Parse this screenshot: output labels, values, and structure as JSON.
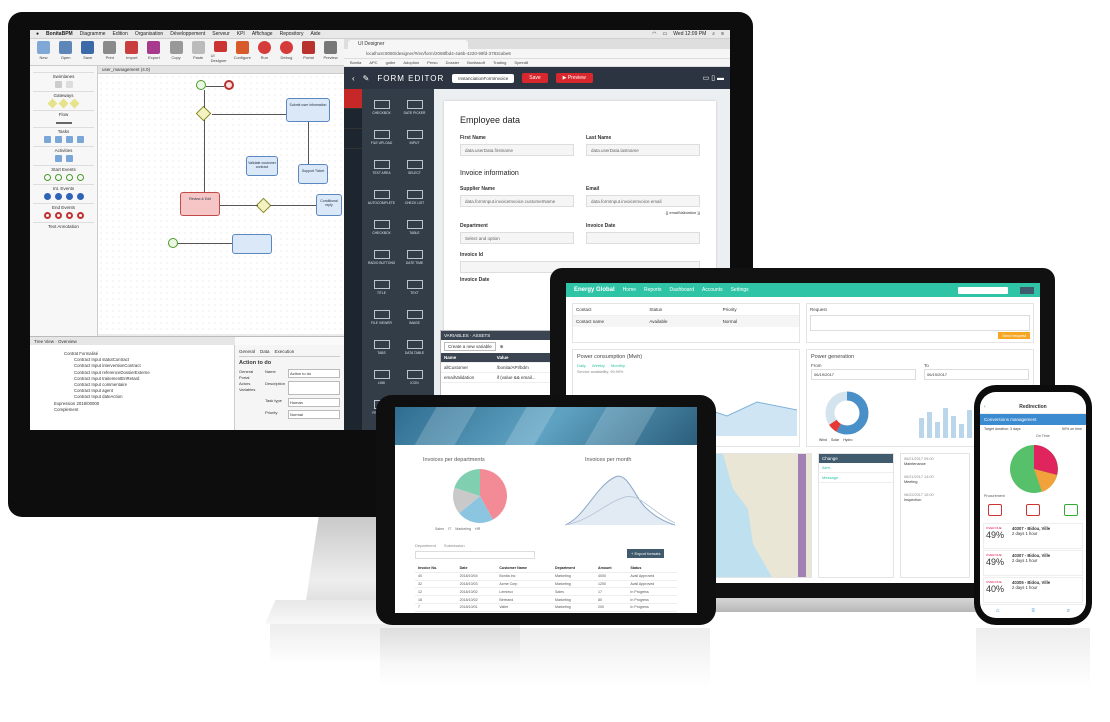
{
  "monitor": {
    "menubar": {
      "app": "BonitaBPM",
      "items": [
        "Diagramme",
        "Edition",
        "Organisation",
        "Développement",
        "Serveur",
        "KPI",
        "Affichage",
        "Repository",
        "Aide"
      ],
      "clock": "Wed 12:09 PM"
    },
    "studio": {
      "toolbar": [
        "New",
        "Open",
        "Save",
        "Print",
        "Import",
        "Export",
        "Copy",
        "Paste",
        "UI Designer",
        "Configure",
        "Run",
        "Debug",
        "Portal",
        "Preview"
      ],
      "palette": {
        "sections": [
          "Swimlanes",
          "Gateways",
          "Flow",
          "Tasks",
          "Activities",
          "Start Events",
          "Int. Events",
          "End Events",
          "Text Annotation"
        ]
      },
      "diagram_tab": "user_management (4.0)",
      "tasks": [
        {
          "label": "Submit user information"
        },
        {
          "label": "Validate customer contract"
        },
        {
          "label": "Support Ticket"
        },
        {
          "label": "Review & Edit"
        },
        {
          "label": "Conditional reply"
        }
      ],
      "tree_tab": "Tree View",
      "overview_tab": "Overview",
      "tree_items": [
        "Contrat Formalisé",
        "Contract Input statutContract",
        "Contract Input interventionContract",
        "Contract Input referenceDossierExterne",
        "Contract Input traitementEnRetard",
        "Contract Input commentaire",
        "Contract Input agent",
        "Contract Input dateAction",
        "Expression 2018/00000",
        "Complement"
      ],
      "props": {
        "tabs": [
          "General",
          "Data",
          "Execution"
        ],
        "title": "Action to do",
        "section": "General",
        "sidebar": [
          "Portal",
          "Actors",
          "Variables"
        ],
        "fields": [
          {
            "label": "Name",
            "value": "Action to do"
          },
          {
            "label": "Description",
            "value": ""
          },
          {
            "label": "Task type",
            "value": "Human"
          },
          {
            "label": "Priority",
            "value": "Normal"
          }
        ]
      }
    },
    "browser": {
      "tab": "UI Designer",
      "url": "localhost:8080/designer/#/en/form/2068fbd4-4a6b-4220-99fd-3783cabe6",
      "bookmarks": [
        "Bonita",
        "APC",
        "gulbe",
        "Adoption",
        "Perso",
        "Dossier",
        "Bonitasoft",
        "Trading",
        "Speed8"
      ],
      "form_editor": {
        "title": "FORM EDITOR",
        "form_name": "InstanciationFormInvoice",
        "save": "Save",
        "preview": "Preview",
        "widgets": [
          "CHECKBOX",
          "DATE PICKER",
          "FILE UPLOAD",
          "INPUT",
          "TEXT AREA",
          "SELECT",
          "AUTOCOMPLETE",
          "CHECK LIST",
          "CHECKBOX",
          "TABLE",
          "RADIO BUTTONS",
          "DATE TIME",
          "TITLE",
          "TEXT",
          "FILE VIEWER",
          "IMAGE",
          "TABS",
          "DATA TABLE",
          "LINK",
          "ICON",
          "FRAGMENT",
          "BUTTON"
        ],
        "sections": {
          "employee": "Employee data",
          "invoice": "Invoice information"
        },
        "fields": [
          {
            "label": "First Name",
            "value": "data.userData.firstname"
          },
          {
            "label": "Last Name",
            "value": "data.userData.lastname"
          },
          {
            "label": "Supplier Name",
            "value": "data.formInput.invoiceInvoice.customerName"
          },
          {
            "label": "Email",
            "value": "data.formInput.invoiceInvoice.email"
          },
          {
            "label": "Department",
            "value": "Select and option"
          },
          {
            "label": "Invoice Date",
            "value": ""
          },
          {
            "label": "Invoice Id",
            "value": ""
          },
          {
            "label": "Invoice Date",
            "value": ""
          }
        ],
        "email_validation": "{{ emailValidation }}"
      },
      "variables_panel": {
        "tabs": [
          "VARIABLES",
          "ASSETS"
        ],
        "create": "Create a new variable",
        "headers": [
          "Name",
          "Value"
        ],
        "rows": [
          {
            "name": "allCustomer",
            "value": "/bonita/API/bdm"
          },
          {
            "name": "emailValidation",
            "value": "if (value && email..."
          }
        ]
      }
    }
  },
  "laptop": {
    "nav": {
      "brand": "Energy Global",
      "items": [
        "Home",
        "Reports",
        "Dashboard",
        "Accounts",
        "Settings"
      ],
      "search_btn": "Search"
    },
    "table_card": {
      "headers": [
        "Contact",
        "Status",
        "Priority"
      ],
      "rows": [
        {
          "name": "Contact name",
          "status": "Available",
          "priority": "Normal"
        }
      ]
    },
    "request": {
      "label": "Request",
      "button": "Send request"
    },
    "consumption": {
      "title": "Power consumption (Mwh)",
      "tabs": [
        "Daily",
        "Weekly",
        "Monthly"
      ],
      "sub": "Service availability: 99.99%"
    },
    "generation": {
      "title": "Power generation",
      "from_label": "From",
      "to_label": "To",
      "from": "06/19/2017",
      "to": "06/19/2017",
      "legend": [
        "Wind",
        "Solar",
        "Hydro"
      ]
    },
    "map_label": "Map",
    "list": {
      "title": "Change",
      "items": [
        "Alert",
        "Message"
      ]
    },
    "events": [
      {
        "date": "06/21/2017 09:00",
        "text": "Maintenance"
      },
      {
        "date": "06/21/2017 14:00",
        "text": "Meeting"
      },
      {
        "date": "06/22/2017 10:00",
        "text": "Inspection"
      }
    ],
    "colors": {
      "brand": "#2ec4a5",
      "accent": "#f5a623"
    }
  },
  "tablet": {
    "chart1_title": "Invoices per departments",
    "chart2_title": "Invoices per month",
    "pie_legend": [
      "Sales",
      "IT",
      "Marketing",
      "HR"
    ],
    "filters": [
      "Department",
      "Submission"
    ],
    "button": "+ Export formats",
    "table": {
      "headers": [
        "Invoice No.",
        "Date",
        "Customer Name",
        "Department",
        "Amount",
        "Status"
      ],
      "rows": [
        [
          "40",
          "2018/10/04",
          "Bonita Inc",
          "Marketing",
          "4000",
          "Avail Approved"
        ],
        [
          "32",
          "2018/10/03",
          "Acme Corp",
          "Marketing",
          "1200",
          "Avail Approved"
        ],
        [
          "12",
          "2018/10/02",
          "Lemieux",
          "Sales",
          "17",
          "In Progress"
        ],
        [
          "18",
          "2018/10/02",
          "Bertrand",
          "Marketing",
          "80",
          "In Progress"
        ],
        [
          "7",
          "2018/10/01",
          "Vallet",
          "Marketing",
          "200",
          "In Progress"
        ]
      ]
    },
    "colors": {
      "pie": [
        "#f28b95",
        "#8cc5df",
        "#c9c9c9",
        "#7fcfb0"
      ]
    }
  },
  "phone": {
    "title": "Redirection",
    "subtitle": "Conversions management",
    "summary": {
      "left": "Target duration: 3 days",
      "right": "50% on time"
    },
    "chart_label": "On Time",
    "tasks_label": "Procurement",
    "cards": [
      {
        "pct": "49%",
        "tag": "OVER DUE",
        "title": "40307 - Bidou, Ville",
        "meta": "2 days 1 hour"
      },
      {
        "pct": "49%",
        "tag": "OVER DUE",
        "title": "40307 - Bidou, Ville",
        "meta": "2 days 1 hour"
      },
      {
        "pct": "40%",
        "tag": "OVER DUE",
        "title": "40305 - Bidou, Ville",
        "meta": "2 days 1 hour"
      }
    ]
  }
}
